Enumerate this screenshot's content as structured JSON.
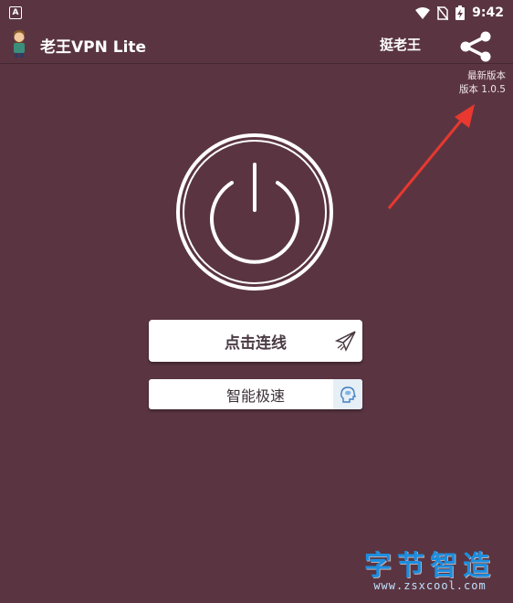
{
  "status_bar": {
    "notification_icon": "A",
    "time": "9:42",
    "icons": [
      "wifi-icon",
      "no-sim-icon",
      "battery-charging-icon"
    ]
  },
  "app_bar": {
    "title": "老王VPN Lite",
    "action_label": "挺老王",
    "logo_icon": "character-avatar-icon",
    "share_icon": "share-icon"
  },
  "version_note": {
    "line1": "最新版本",
    "line2": "版本 1.0.5"
  },
  "power_button": {
    "icon": "power-icon"
  },
  "buttons": {
    "connect_label": "点击连线",
    "connect_icon": "paper-plane-icon",
    "speed_label": "智能极速",
    "speed_icon": "brain-head-icon"
  },
  "watermark": {
    "title": "字节智造",
    "url": "www.zsxcool.com"
  },
  "colors": {
    "background": "#5a3541",
    "arrow": "#e8382f",
    "watermark_blue": "#1c8ee0"
  }
}
